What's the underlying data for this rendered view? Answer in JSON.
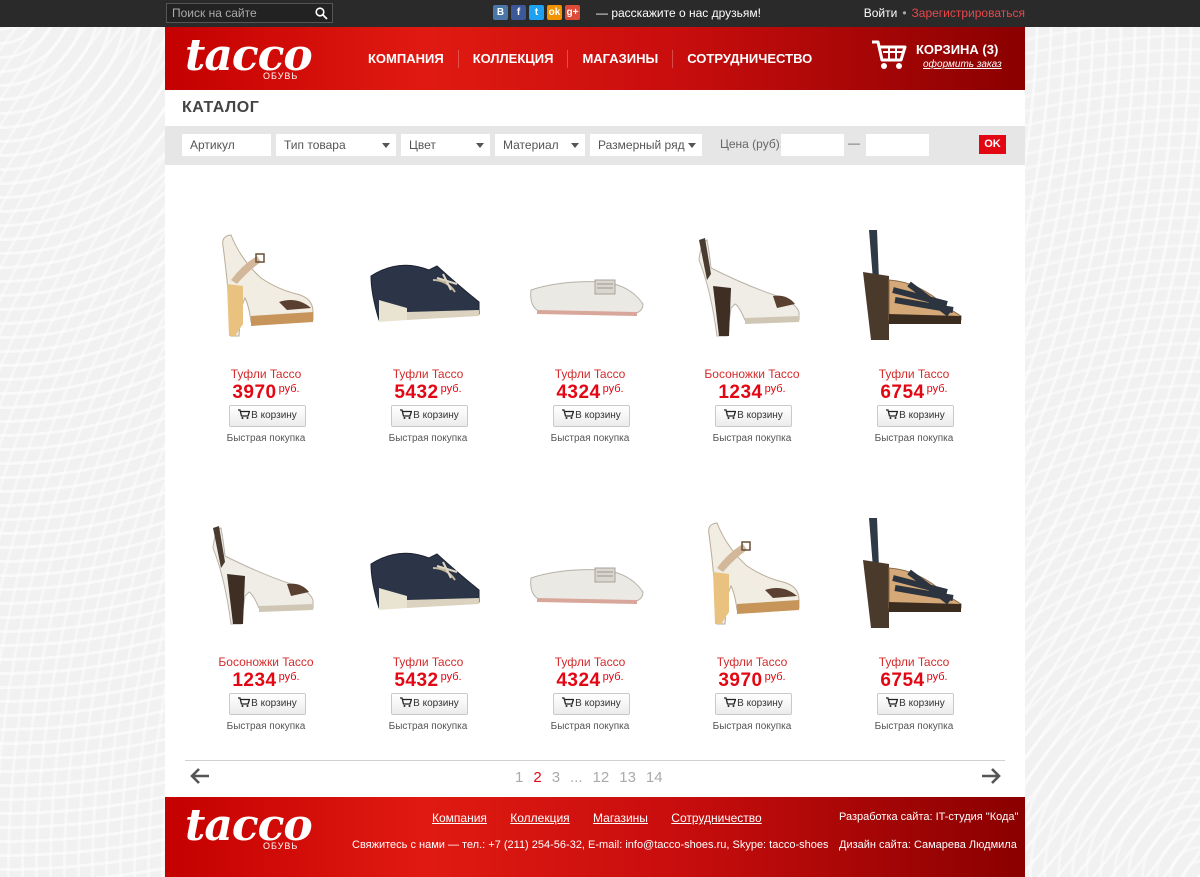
{
  "topbar": {
    "search_placeholder": "Поиск на сайте",
    "share_text": "— расскажите о нас друзьям!",
    "social": [
      {
        "name": "vk-icon",
        "glyph": "B",
        "color": "#4a76a8"
      },
      {
        "name": "facebook-icon",
        "glyph": "f",
        "color": "#3b5998"
      },
      {
        "name": "twitter-icon",
        "glyph": "t",
        "color": "#1da1f2"
      },
      {
        "name": "odnoklassniki-icon",
        "glyph": "ok",
        "color": "#f29400"
      },
      {
        "name": "google-plus-icon",
        "glyph": "g+",
        "color": "#dd4b39"
      }
    ],
    "login": "Войти",
    "dot": "•",
    "register": "Зарегистрироваться"
  },
  "header": {
    "logo": "tacco",
    "logo_sub": "ОБУВЬ",
    "nav": [
      "КОМПАНИЯ",
      "КОЛЛЕКЦИЯ",
      "МАГАЗИНЫ",
      "СОТРУДНИЧЕСТВО"
    ],
    "cart_title": "КОРЗИНА (3)",
    "cart_link": "оформить заказ"
  },
  "catalog": {
    "title": "КАТАЛОГ",
    "filters": {
      "article": "Артикул",
      "type": "Тип товара",
      "color": "Цвет",
      "material": "Материал",
      "size": "Размерный ряд",
      "price_label": "Цена (руб):",
      "dash": "—",
      "ok": "OK"
    },
    "currency": "руб.",
    "add_to_cart": "В корзину",
    "quick_buy": "Быстрая покупка",
    "products": [
      {
        "name": "Туфли Tacco",
        "price": "3970",
        "kind": "mary-jane"
      },
      {
        "name": "Туфли Tacco",
        "price": "5432",
        "kind": "loafer"
      },
      {
        "name": "Туфли Tacco",
        "price": "4324",
        "kind": "flat"
      },
      {
        "name": "Босоножки Tacco",
        "price": "1234",
        "kind": "slingback"
      },
      {
        "name": "Туфли Tacco",
        "price": "6754",
        "kind": "sandal"
      },
      {
        "name": "Босоножки Tacco",
        "price": "1234",
        "kind": "slingback"
      },
      {
        "name": "Туфли Tacco",
        "price": "5432",
        "kind": "loafer"
      },
      {
        "name": "Туфли Tacco",
        "price": "4324",
        "kind": "flat"
      },
      {
        "name": "Туфли Tacco",
        "price": "3970",
        "kind": "mary-jane"
      },
      {
        "name": "Туфли Tacco",
        "price": "6754",
        "kind": "sandal"
      }
    ]
  },
  "pagination": {
    "pages": [
      "1",
      "2",
      "3",
      "...",
      "12",
      "13",
      "14"
    ],
    "current": "2"
  },
  "footer": {
    "logo": "tacco",
    "logo_sub": "ОБУВЬ",
    "nav": [
      "Компания",
      "Коллекция",
      "Магазины",
      "Сотрудничество"
    ],
    "contact": "Свяжитесь с нами — тел.: +7 (211) 254-56-32, E-mail: info@tacco-shoes.ru, Skype: tacco-shoes",
    "developer": "Разработка сайта: IT-студия \"Кода\"",
    "designer": "Дизайн сайта: Самарева Людмила"
  }
}
